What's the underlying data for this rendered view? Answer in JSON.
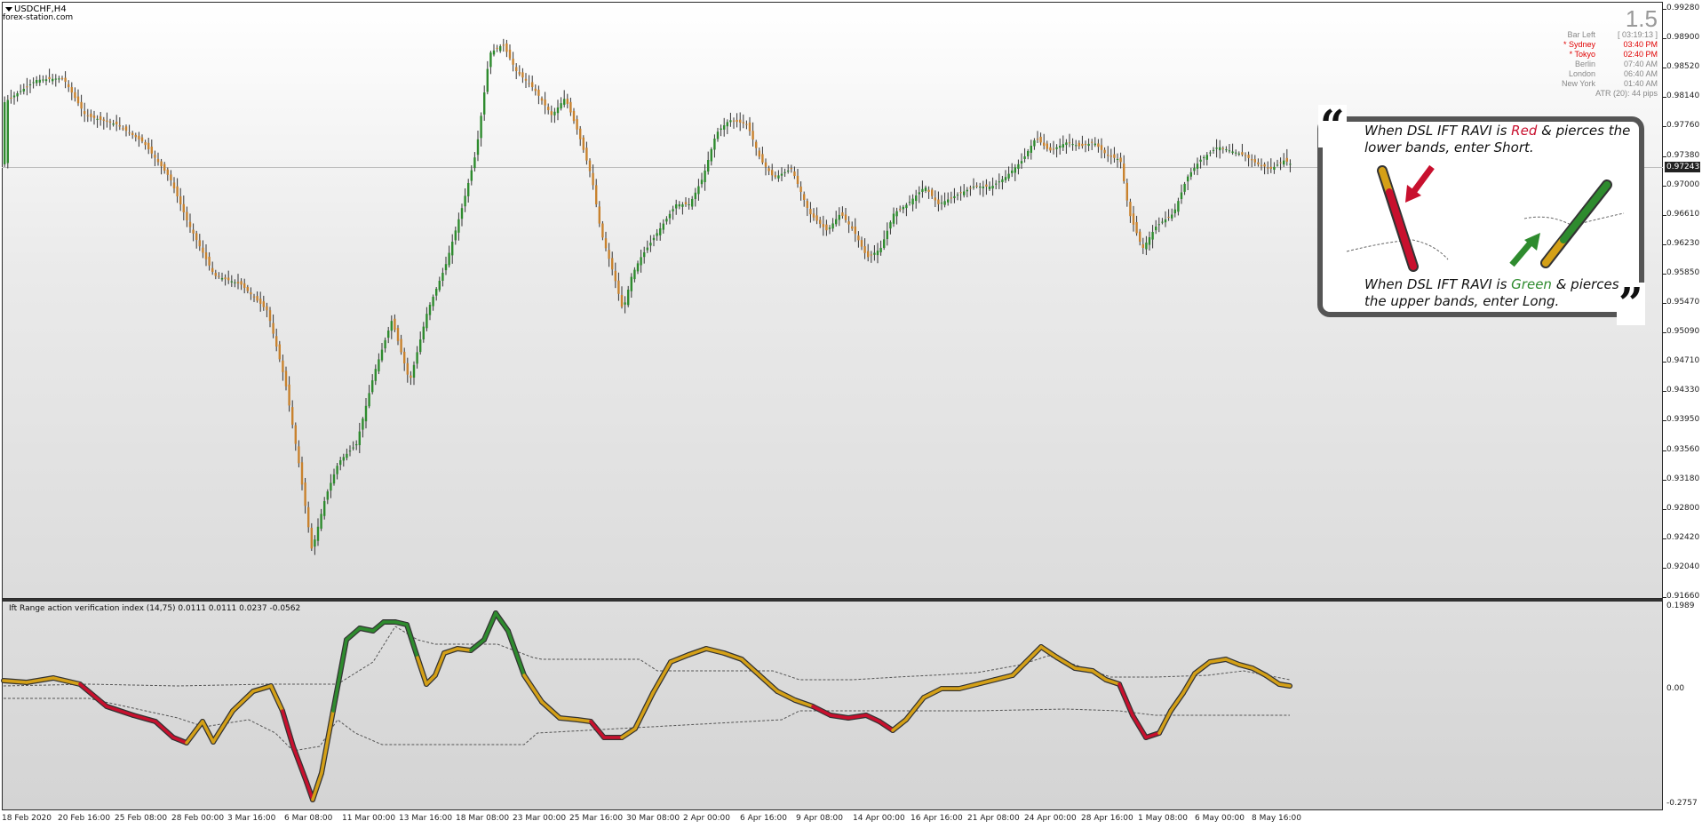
{
  "chart": {
    "symbol_title": "USDCHF,H4",
    "site": "forex-station.com",
    "current_price": "0.97243",
    "price_axis": [
      "0.99280",
      "0.98900",
      "0.98520",
      "0.98140",
      "0.97760",
      "0.97380",
      "0.97000",
      "0.96610",
      "0.96230",
      "0.95850",
      "0.95470",
      "0.95090",
      "0.94710",
      "0.94330",
      "0.93950",
      "0.93560",
      "0.93180",
      "0.92800",
      "0.92420",
      "0.92040",
      "0.91660"
    ],
    "sub_axis": [
      "0.1989",
      "0.00",
      "-0.2757"
    ],
    "time_axis": [
      "18 Feb 2020",
      "20 Feb 16:00",
      "25 Feb 08:00",
      "28 Feb 00:00",
      "3 Mar 16:00",
      "6 Mar 08:00",
      "11 Mar 00:00",
      "13 Mar 16:00",
      "18 Mar 08:00",
      "23 Mar 00:00",
      "25 Mar 16:00",
      "30 Mar 08:00",
      "2 Apr 00:00",
      "6 Apr 16:00",
      "9 Apr 08:00",
      "14 Apr 00:00",
      "16 Apr 16:00",
      "21 Apr 08:00",
      "24 Apr 00:00",
      "28 Apr 16:00",
      "1 May 08:00",
      "6 May 00:00",
      "8 May 16:00"
    ],
    "indicator_title": "Ift Range action verification index (14,75) 0.0111 0.0111 0.0237 -0.0562"
  },
  "info_panel": {
    "bar_left_value": "1.5",
    "rows": [
      {
        "name": "Bar Left",
        "value": "[ 03:19:13 ]",
        "color": "#888888"
      },
      {
        "name": "* Sydney",
        "value": "03:40 PM",
        "color": "#e00000"
      },
      {
        "name": "* Tokyo",
        "value": "02:40 PM",
        "color": "#e00000"
      },
      {
        "name": "Berlin",
        "value": "07:40 AM",
        "color": "#888888"
      },
      {
        "name": "London",
        "value": "06:40 AM",
        "color": "#888888"
      },
      {
        "name": "New York",
        "value": "01:40 AM",
        "color": "#888888"
      }
    ],
    "atr": "ATR (20): 44 pips"
  },
  "callout": {
    "short_pre": "When DSL IFT RAVI is ",
    "short_color_word": "Red",
    "short_post": " & pierces the",
    "short_line2": "lower bands, enter Short.",
    "long_pre": "When DSL IFT RAVI is ",
    "long_color_word": "Green",
    "long_post": " & pierces",
    "long_line2": "the upper bands, enter Long.",
    "open_quote": "“",
    "close_quote": "”"
  },
  "colors": {
    "bull_candle": "#2e8b2e",
    "bear_candle": "#c8822e",
    "indicator_red": "#c8102e",
    "indicator_green": "#2e8b2e",
    "indicator_gold": "#d4a017"
  }
}
